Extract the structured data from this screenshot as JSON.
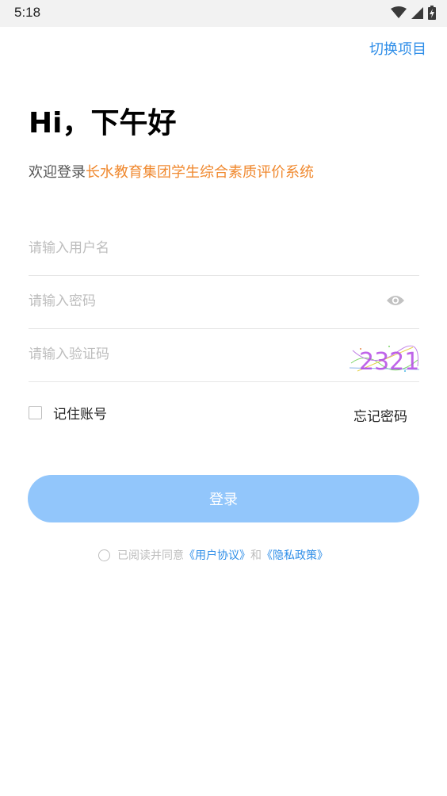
{
  "status_bar": {
    "time": "5:18"
  },
  "header": {
    "switch_project": "切换项目"
  },
  "greeting": "Hi，下午好",
  "welcome": {
    "prefix": "欢迎登录",
    "system_name": "长水教育集团学生综合素质评价系统"
  },
  "form": {
    "username_placeholder": "请输入用户名",
    "password_placeholder": "请输入密码",
    "captcha_placeholder": "请输入验证码",
    "captcha_text": "2321"
  },
  "remember_label": "记住账号",
  "forgot_label": "忘记密码",
  "login_label": "登录",
  "agreement": {
    "prefix": "已阅读并同意",
    "user_agreement": "《用户协议》",
    "conjunction": "和",
    "privacy_policy": "《隐私政策》"
  },
  "colors": {
    "accent": "#2f8ee8",
    "system_name": "#f0892f",
    "login_button": "#92c6fb"
  }
}
